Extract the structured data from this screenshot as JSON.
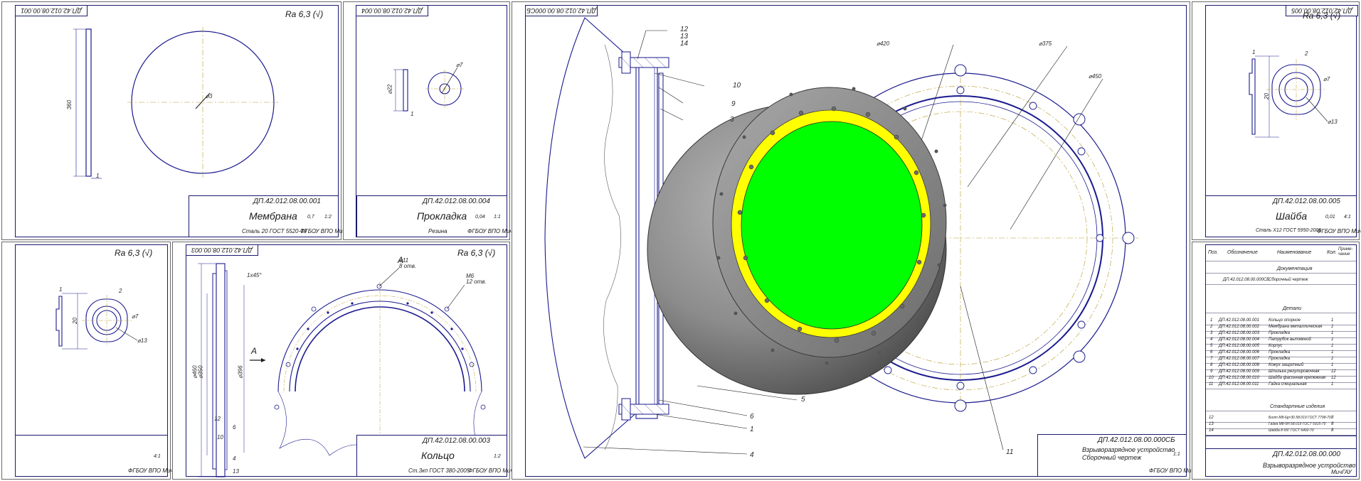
{
  "sheets": {
    "membrane": {
      "code_mirrored": "ДП.42.012.08.00.001",
      "roughness": "Ra 6,3 (√)",
      "dim_height": "360",
      "dim_thickness": "1",
      "dim_diameter": "⌀3",
      "title_code": "ДП.42.012.08.00.001",
      "title_name": "Мембрана",
      "material": "Сталь 20 ГОСТ 5520-79",
      "org": "ФГБОУ ВПО МичГАУ",
      "mass": "0,7",
      "scale": "1:2"
    },
    "gasket": {
      "code_mirrored": "ДП.42.012.08.00.004",
      "dim_height": "⌀22",
      "dim_thickness": "1",
      "dim_hole": "⌀7",
      "title_code": "ДП.42.012.08.00.004",
      "title_name": "Прокладка",
      "material": "Резина",
      "org": "ФГБОУ ВПО МичГАУ",
      "mass": "0,04",
      "scale": "1:1"
    },
    "washer_small": {
      "roughness": "Ra 6,3 (√)",
      "dim_1": "1",
      "dim_2": "2",
      "dim_20": "20",
      "dim_d7": "⌀7",
      "dim_d13": "⌀13",
      "scale": "4:1",
      "org": "ФГБОУ ВПО МичГАУ"
    },
    "ring": {
      "code_mirrored": "ДП.42.012.08.00.003",
      "roughness": "Ra 6,3 (√)",
      "view_label": "А",
      "view_arrow": "А",
      "dim_d460": "⌀460",
      "dim_d350": "⌀350",
      "dim_d396": "⌀396",
      "dim_chamfer": "1x45°",
      "dim_12": "12",
      "dim_10": "10",
      "dim_6": "6",
      "dim_4": "4",
      "dim_13": "13",
      "note_holes": "⌀11\n8 отв.",
      "note_thread": "М6\n12 отв.",
      "title_code": "ДП.42.012.08.00.003",
      "title_name": "Кольцо",
      "material": "Ст.3кп ГОСТ 380-2005",
      "org": "ФГБОУ ВПО МичГАУ",
      "scale": "1:2"
    },
    "assembly": {
      "code_mirrored": "ДП.42.012.08.00.000СБ",
      "callouts": [
        "12",
        "13",
        "14",
        "10",
        "9",
        "3",
        "6",
        "1",
        "4",
        "5",
        "11"
      ],
      "dim_d420": "⌀420",
      "dim_d375": "⌀375",
      "dim_d450": "⌀450",
      "title_code": "ДП.42.012.08.00.000СБ",
      "title_name": "Взрыворазрядное устройство\nСборочный чертеж",
      "org": "ФГБОУ ВПО МичГАУ",
      "scale": "1:1"
    },
    "washer": {
      "code_mirrored": "ДП.42.012.08.00.005",
      "roughness": "Ra 6,3 (√)",
      "dim_1": "1",
      "dim_2": "2",
      "dim_20": "20",
      "dim_d7": "⌀7",
      "dim_d13": "⌀13",
      "title_code": "ДП.42.012.08.00.005",
      "title_name": "Шайба",
      "material": "Сталь Х12 ГОСТ 5950-2000",
      "org": "ФГБОУ ВПО МичГАУ",
      "mass": "0,01",
      "scale": "4:1"
    },
    "specification": {
      "header": [
        "Поз.",
        "Обозначение",
        "Наименование",
        "Кол.",
        "Приме-чание"
      ],
      "section_docs": "Документация",
      "doc_row": {
        "code": "ДП.42.012.08.00.000СБ",
        "name": "Сборочный чертеж"
      },
      "section_parts": "Детали",
      "parts": [
        {
          "pos": "1",
          "code": "ДП.42.012.08.00.001",
          "name": "Кольцо опорное",
          "qty": "1"
        },
        {
          "pos": "2",
          "code": "ДП.42.012.08.00.002",
          "name": "Мембрана металлическая",
          "qty": "1"
        },
        {
          "pos": "3",
          "code": "ДП.42.012.08.00.003",
          "name": "Прокладка",
          "qty": "1"
        },
        {
          "pos": "4",
          "code": "ДП.42.012.08.00.004",
          "name": "Патрубок вытяжной",
          "qty": "1"
        },
        {
          "pos": "5",
          "code": "ДП.42.012.08.00.005",
          "name": "Корпус",
          "qty": "1"
        },
        {
          "pos": "6",
          "code": "ДП.42.012.08.00.006",
          "name": "Прокладка",
          "qty": "1"
        },
        {
          "pos": "7",
          "code": "ДП.42.012.08.00.007",
          "name": "Прокладка",
          "qty": "1"
        },
        {
          "pos": "8",
          "code": "ДП.42.012.08.00.008",
          "name": "Кожух защитный",
          "qty": "1"
        },
        {
          "pos": "9",
          "code": "ДП.42.012.08.00.009",
          "name": "Шпилька регулировочная",
          "qty": "12"
        },
        {
          "pos": "10",
          "code": "ДП.42.012.08.00.010",
          "name": "Шайба фасонная крепежная",
          "qty": "12"
        },
        {
          "pos": "11",
          "code": "ДП.42.012.08.00.011",
          "name": "Гайка специальная",
          "qty": "1"
        }
      ],
      "section_std": "Стандартные изделия",
      "std": [
        {
          "pos": "12",
          "name": "Болт М8-6g×30.58.019 ГОСТ 7798-70",
          "qty": "8"
        },
        {
          "pos": "13",
          "name": "Гайка М8-5Н.58.019 ГОСТ 5915-70",
          "qty": "8"
        },
        {
          "pos": "14",
          "name": "Шайба 8 65Г ГОСТ 6402-70",
          "qty": "8"
        }
      ],
      "title_code": "ДП.42.012.08.00.000",
      "title_name": "Взрыворазрядное устройство",
      "org": "МичГАУ"
    }
  },
  "colors": {
    "line": "#1a1a8e",
    "center": "#b89a2a",
    "green": "#00ff00",
    "yellow": "#ffff00",
    "gray_dark": "#4a4a4a",
    "gray_light": "#9a9a9a"
  }
}
